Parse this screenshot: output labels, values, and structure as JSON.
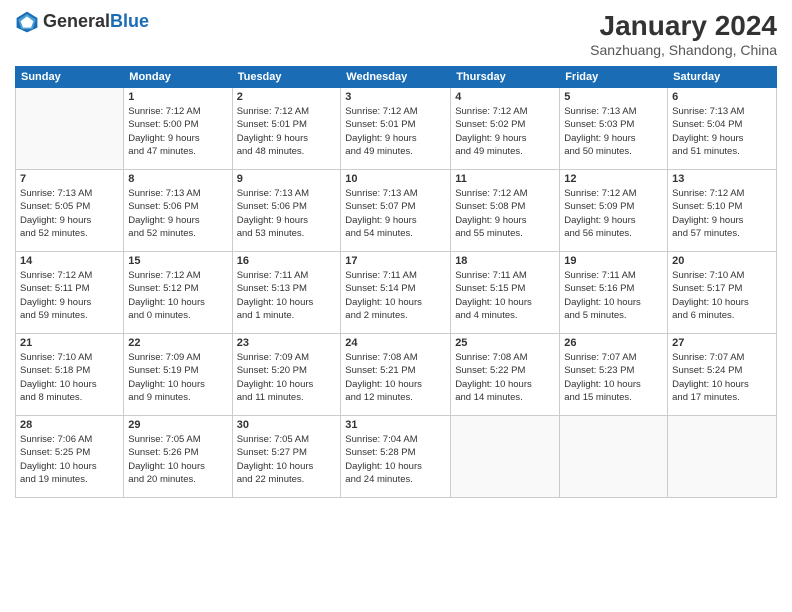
{
  "logo": {
    "general": "General",
    "blue": "Blue"
  },
  "header": {
    "month_title": "January 2024",
    "subtitle": "Sanzhuang, Shandong, China"
  },
  "days_of_week": [
    "Sunday",
    "Monday",
    "Tuesday",
    "Wednesday",
    "Thursday",
    "Friday",
    "Saturday"
  ],
  "weeks": [
    [
      {
        "day": "",
        "info": ""
      },
      {
        "day": "1",
        "info": "Sunrise: 7:12 AM\nSunset: 5:00 PM\nDaylight: 9 hours\nand 47 minutes."
      },
      {
        "day": "2",
        "info": "Sunrise: 7:12 AM\nSunset: 5:01 PM\nDaylight: 9 hours\nand 48 minutes."
      },
      {
        "day": "3",
        "info": "Sunrise: 7:12 AM\nSunset: 5:01 PM\nDaylight: 9 hours\nand 49 minutes."
      },
      {
        "day": "4",
        "info": "Sunrise: 7:12 AM\nSunset: 5:02 PM\nDaylight: 9 hours\nand 49 minutes."
      },
      {
        "day": "5",
        "info": "Sunrise: 7:13 AM\nSunset: 5:03 PM\nDaylight: 9 hours\nand 50 minutes."
      },
      {
        "day": "6",
        "info": "Sunrise: 7:13 AM\nSunset: 5:04 PM\nDaylight: 9 hours\nand 51 minutes."
      }
    ],
    [
      {
        "day": "7",
        "info": "Sunrise: 7:13 AM\nSunset: 5:05 PM\nDaylight: 9 hours\nand 52 minutes."
      },
      {
        "day": "8",
        "info": "Sunrise: 7:13 AM\nSunset: 5:06 PM\nDaylight: 9 hours\nand 52 minutes."
      },
      {
        "day": "9",
        "info": "Sunrise: 7:13 AM\nSunset: 5:06 PM\nDaylight: 9 hours\nand 53 minutes."
      },
      {
        "day": "10",
        "info": "Sunrise: 7:13 AM\nSunset: 5:07 PM\nDaylight: 9 hours\nand 54 minutes."
      },
      {
        "day": "11",
        "info": "Sunrise: 7:12 AM\nSunset: 5:08 PM\nDaylight: 9 hours\nand 55 minutes."
      },
      {
        "day": "12",
        "info": "Sunrise: 7:12 AM\nSunset: 5:09 PM\nDaylight: 9 hours\nand 56 minutes."
      },
      {
        "day": "13",
        "info": "Sunrise: 7:12 AM\nSunset: 5:10 PM\nDaylight: 9 hours\nand 57 minutes."
      }
    ],
    [
      {
        "day": "14",
        "info": "Sunrise: 7:12 AM\nSunset: 5:11 PM\nDaylight: 9 hours\nand 59 minutes."
      },
      {
        "day": "15",
        "info": "Sunrise: 7:12 AM\nSunset: 5:12 PM\nDaylight: 10 hours\nand 0 minutes."
      },
      {
        "day": "16",
        "info": "Sunrise: 7:11 AM\nSunset: 5:13 PM\nDaylight: 10 hours\nand 1 minute."
      },
      {
        "day": "17",
        "info": "Sunrise: 7:11 AM\nSunset: 5:14 PM\nDaylight: 10 hours\nand 2 minutes."
      },
      {
        "day": "18",
        "info": "Sunrise: 7:11 AM\nSunset: 5:15 PM\nDaylight: 10 hours\nand 4 minutes."
      },
      {
        "day": "19",
        "info": "Sunrise: 7:11 AM\nSunset: 5:16 PM\nDaylight: 10 hours\nand 5 minutes."
      },
      {
        "day": "20",
        "info": "Sunrise: 7:10 AM\nSunset: 5:17 PM\nDaylight: 10 hours\nand 6 minutes."
      }
    ],
    [
      {
        "day": "21",
        "info": "Sunrise: 7:10 AM\nSunset: 5:18 PM\nDaylight: 10 hours\nand 8 minutes."
      },
      {
        "day": "22",
        "info": "Sunrise: 7:09 AM\nSunset: 5:19 PM\nDaylight: 10 hours\nand 9 minutes."
      },
      {
        "day": "23",
        "info": "Sunrise: 7:09 AM\nSunset: 5:20 PM\nDaylight: 10 hours\nand 11 minutes."
      },
      {
        "day": "24",
        "info": "Sunrise: 7:08 AM\nSunset: 5:21 PM\nDaylight: 10 hours\nand 12 minutes."
      },
      {
        "day": "25",
        "info": "Sunrise: 7:08 AM\nSunset: 5:22 PM\nDaylight: 10 hours\nand 14 minutes."
      },
      {
        "day": "26",
        "info": "Sunrise: 7:07 AM\nSunset: 5:23 PM\nDaylight: 10 hours\nand 15 minutes."
      },
      {
        "day": "27",
        "info": "Sunrise: 7:07 AM\nSunset: 5:24 PM\nDaylight: 10 hours\nand 17 minutes."
      }
    ],
    [
      {
        "day": "28",
        "info": "Sunrise: 7:06 AM\nSunset: 5:25 PM\nDaylight: 10 hours\nand 19 minutes."
      },
      {
        "day": "29",
        "info": "Sunrise: 7:05 AM\nSunset: 5:26 PM\nDaylight: 10 hours\nand 20 minutes."
      },
      {
        "day": "30",
        "info": "Sunrise: 7:05 AM\nSunset: 5:27 PM\nDaylight: 10 hours\nand 22 minutes."
      },
      {
        "day": "31",
        "info": "Sunrise: 7:04 AM\nSunset: 5:28 PM\nDaylight: 10 hours\nand 24 minutes."
      },
      {
        "day": "",
        "info": ""
      },
      {
        "day": "",
        "info": ""
      },
      {
        "day": "",
        "info": ""
      }
    ]
  ]
}
